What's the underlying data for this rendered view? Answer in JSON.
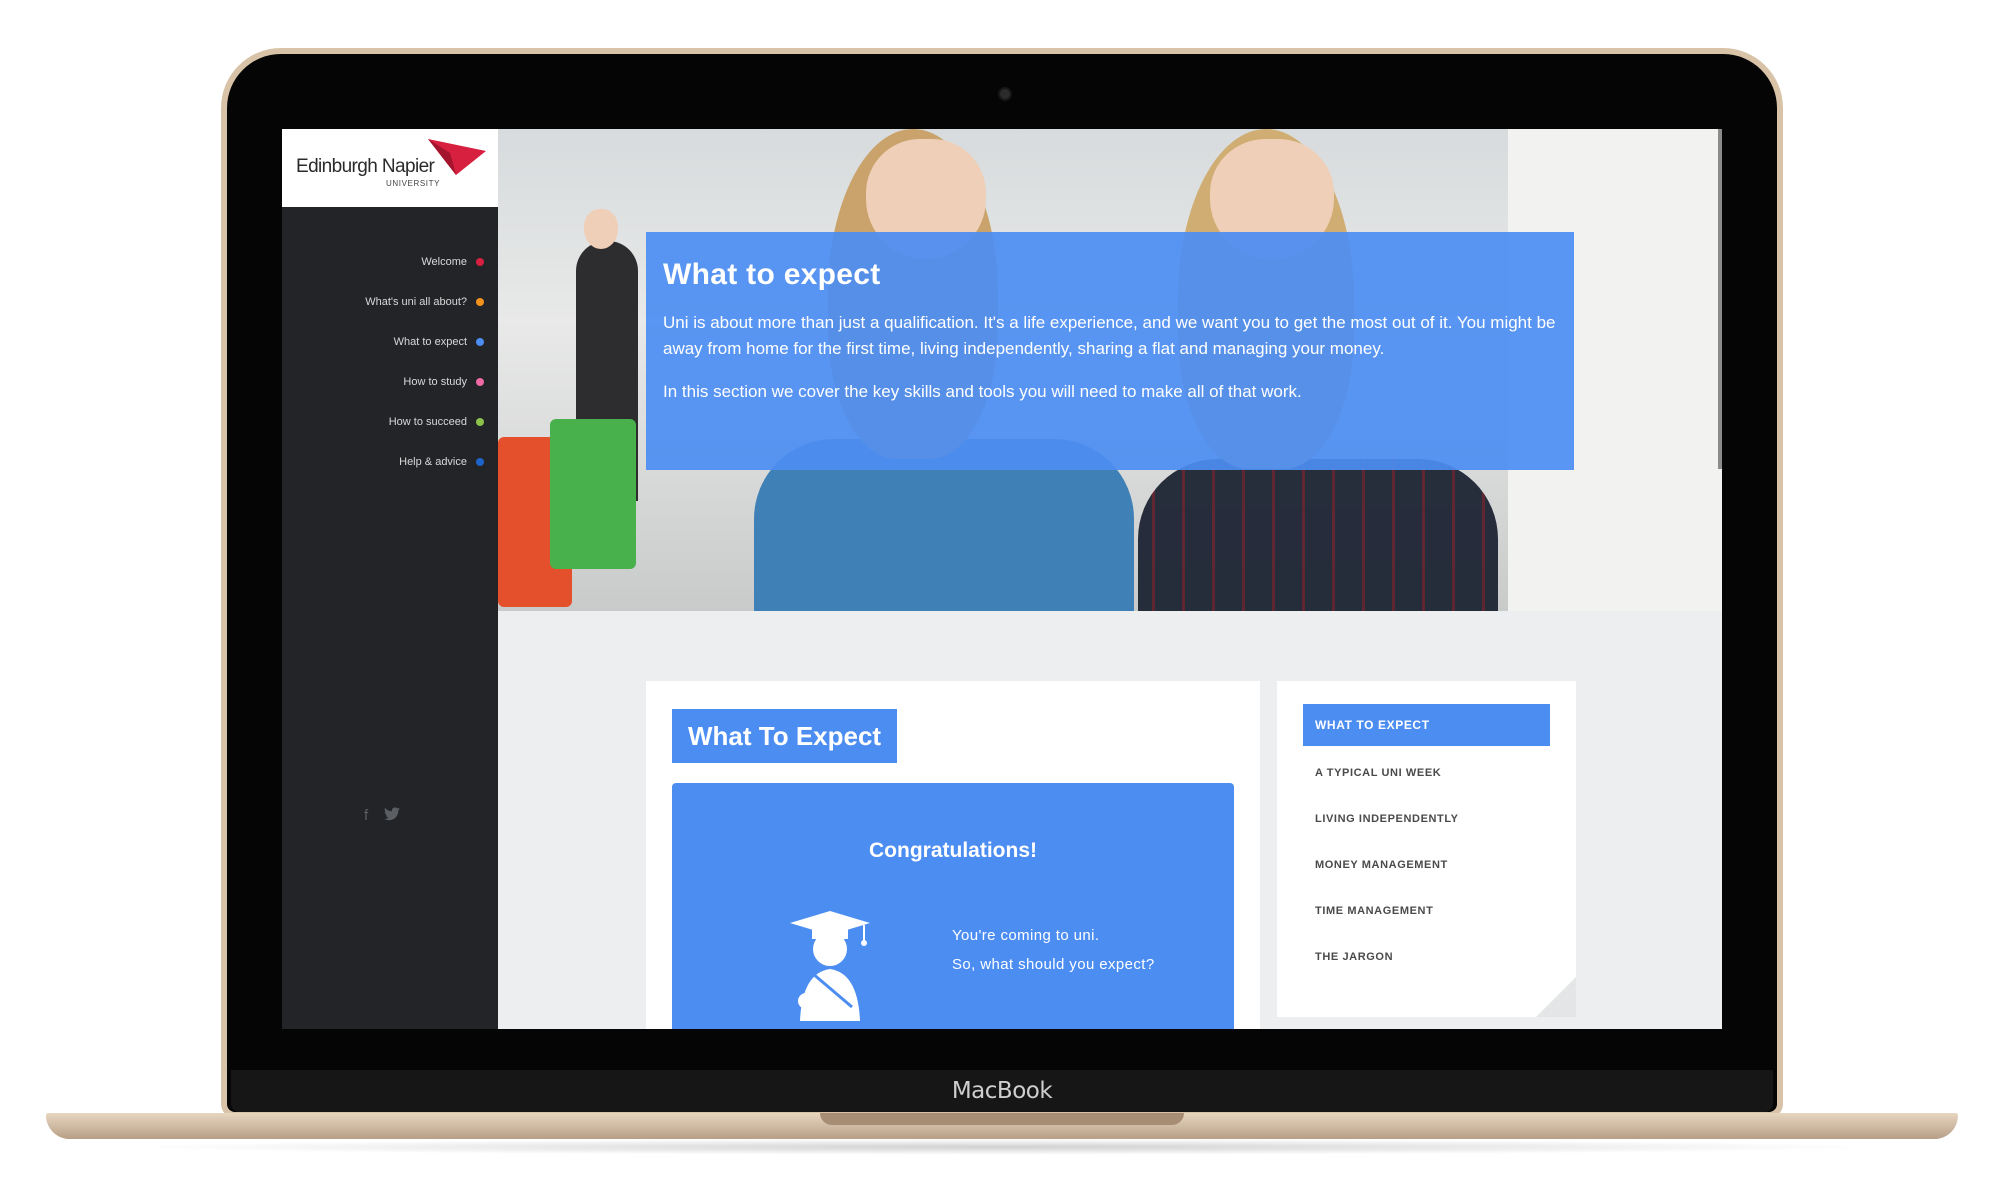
{
  "device": {
    "label": "MacBook"
  },
  "brand": {
    "name": "Edinburgh Napier",
    "subtitle": "UNIVERSITY",
    "accent": "#d71f3f"
  },
  "sidebar": {
    "items": [
      {
        "label": "Welcome",
        "dot": "#d71f3f"
      },
      {
        "label": "What's uni all about?",
        "dot": "#f2921d"
      },
      {
        "label": "What to expect",
        "dot": "#4c8df2"
      },
      {
        "label": "How to study",
        "dot": "#ef6aa4"
      },
      {
        "label": "How to succeed",
        "dot": "#8bc34a"
      },
      {
        "label": "Help & advice",
        "dot": "#1e63c7"
      }
    ],
    "social": {
      "facebook_icon": "f",
      "twitter_icon": "🐦"
    }
  },
  "hero": {
    "title": "What to expect",
    "paragraph1": "Uni is about more than just a qualification. It's a life experience, and we want you to get the most out of it. You might be away from home for the first time, living independently, sharing a flat and managing your money.",
    "paragraph2": "In this section we cover the key skills and tools you will need to make all of that work."
  },
  "main": {
    "badge": "What To Expect",
    "heading": "Congratulations!",
    "line1": "You're coming to uni.",
    "line2": "So, what should you expect?"
  },
  "section_nav": {
    "items": [
      {
        "label": "WHAT TO EXPECT",
        "active": true
      },
      {
        "label": "A TYPICAL UNI WEEK"
      },
      {
        "label": "LIVING INDEPENDENTLY"
      },
      {
        "label": "MONEY MANAGEMENT"
      },
      {
        "label": "TIME MANAGEMENT"
      },
      {
        "label": "THE JARGON"
      }
    ]
  },
  "colors": {
    "primary": "#4c8df2",
    "sidebar_bg": "#222427",
    "page_bg": "#eceeef"
  }
}
